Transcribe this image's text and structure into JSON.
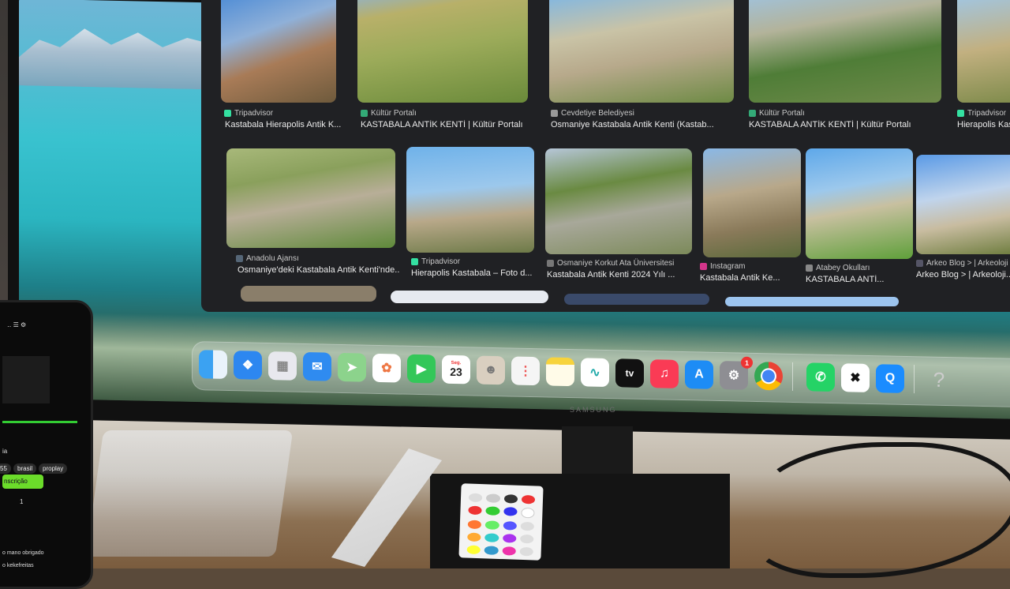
{
  "browser": {
    "row1": [
      {
        "source": "Tripadvisor",
        "title": "Kastabala Hierapolis Antik K..."
      },
      {
        "source": "Kültür Portalı",
        "title": "KASTABALA ANTİK KENTİ | Kültür Portalı"
      },
      {
        "source": "Cevdetiye Belediyesi",
        "title": "Osmaniye Kastabala Antik Kenti (Kastab..."
      },
      {
        "source": "Kültür Portalı",
        "title": "KASTABALA ANTİK KENTİ | Kültür Portalı"
      },
      {
        "source": "Tripadvisor",
        "title": "Hierapolis Kas..."
      }
    ],
    "row2": [
      {
        "source": "Anadolu Ajansı",
        "title": "Osmaniye'deki Kastabala Antik Kenti'nde..."
      },
      {
        "source": "Tripadvisor",
        "title": "Hierapolis Kastabala – Foto d..."
      },
      {
        "source": "Osmaniye Korkut Ata Üniversitesi",
        "title": "Kastabala Antik Kenti 2024 Yılı ..."
      },
      {
        "source": "Instagram",
        "title": "Kastabala Antik Ke..."
      },
      {
        "source": "Atabey Okulları",
        "title": "KASTABALA ANTİ..."
      },
      {
        "source": "Arkeo Blog > | Arkeoloji",
        "title": "Arkeo Blog > | Arkeoloji..."
      }
    ]
  },
  "dock": {
    "calendar_month": "Seg.",
    "calendar_day": "23",
    "tv_label": "tv",
    "settings_badge": "1",
    "help_symbol": "?"
  },
  "monitor": {
    "brand": "SAMSUNG"
  },
  "phone": {
    "label_a": "ia",
    "pills": [
      "55",
      "brasil",
      "proplay"
    ],
    "button": "nscrição",
    "num": "1",
    "msg1": "o mano obrigado",
    "msg2": "o kekefreitas"
  }
}
